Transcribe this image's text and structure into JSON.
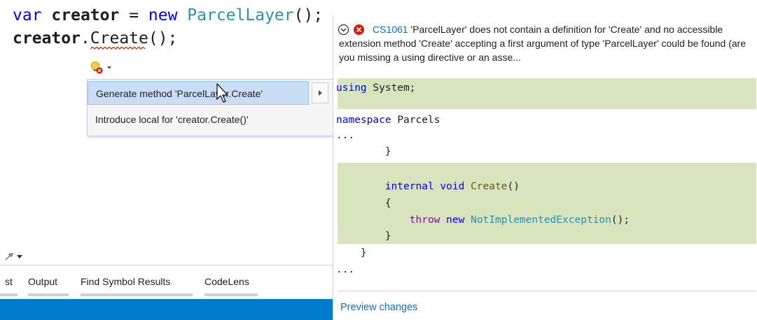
{
  "editor": {
    "line1": {
      "kw_var": "var",
      "identifier": "creator",
      "equals": " = ",
      "kw_new": "new",
      "type": "ParcelLayer",
      "tail": "();"
    },
    "line2": {
      "object": "creator",
      "dot": ".",
      "method": "Create",
      "tail": "();"
    }
  },
  "lightbulb": {
    "icon": "lightbulb-error-icon"
  },
  "quick_actions": {
    "items": [
      {
        "label": "Generate method 'ParcelLayer.Create'"
      },
      {
        "label": "Introduce local for 'creator.Create()'"
      }
    ]
  },
  "preview": {
    "error_code": "CS1061",
    "error_message": "'ParcelLayer' does not contain a definition for 'Create' and no accessible extension method 'Create' accepting a first argument of type 'ParcelLayer' could be found (are you missing a using directive or an asse...",
    "code": {
      "using_kw": "using",
      "using_ns": "System;",
      "namespace_kw": "namespace",
      "namespace_name": "Parcels",
      "ellipsis": "...",
      "close_brace": "}",
      "internal_kw": "internal",
      "void_kw": "void",
      "method_name": "Create",
      "parens": "()",
      "open_brace": "{",
      "throw_kw": "throw",
      "new_kw": "new",
      "exception_type": "NotImplementedException",
      "call_tail": "();"
    },
    "footer_link": "Preview changes"
  },
  "tool_windows": {
    "tabs": [
      "st",
      "Output",
      "Find Symbol Results",
      "CodeLens"
    ]
  },
  "colors": {
    "keyword": "#0000ff",
    "type": "#2b91af",
    "added_highlight": "#d8e4bc",
    "menu_selection": "#c9def5",
    "status_bar": "#007acc",
    "error_red": "#e51400",
    "link": "#0e70c0"
  }
}
